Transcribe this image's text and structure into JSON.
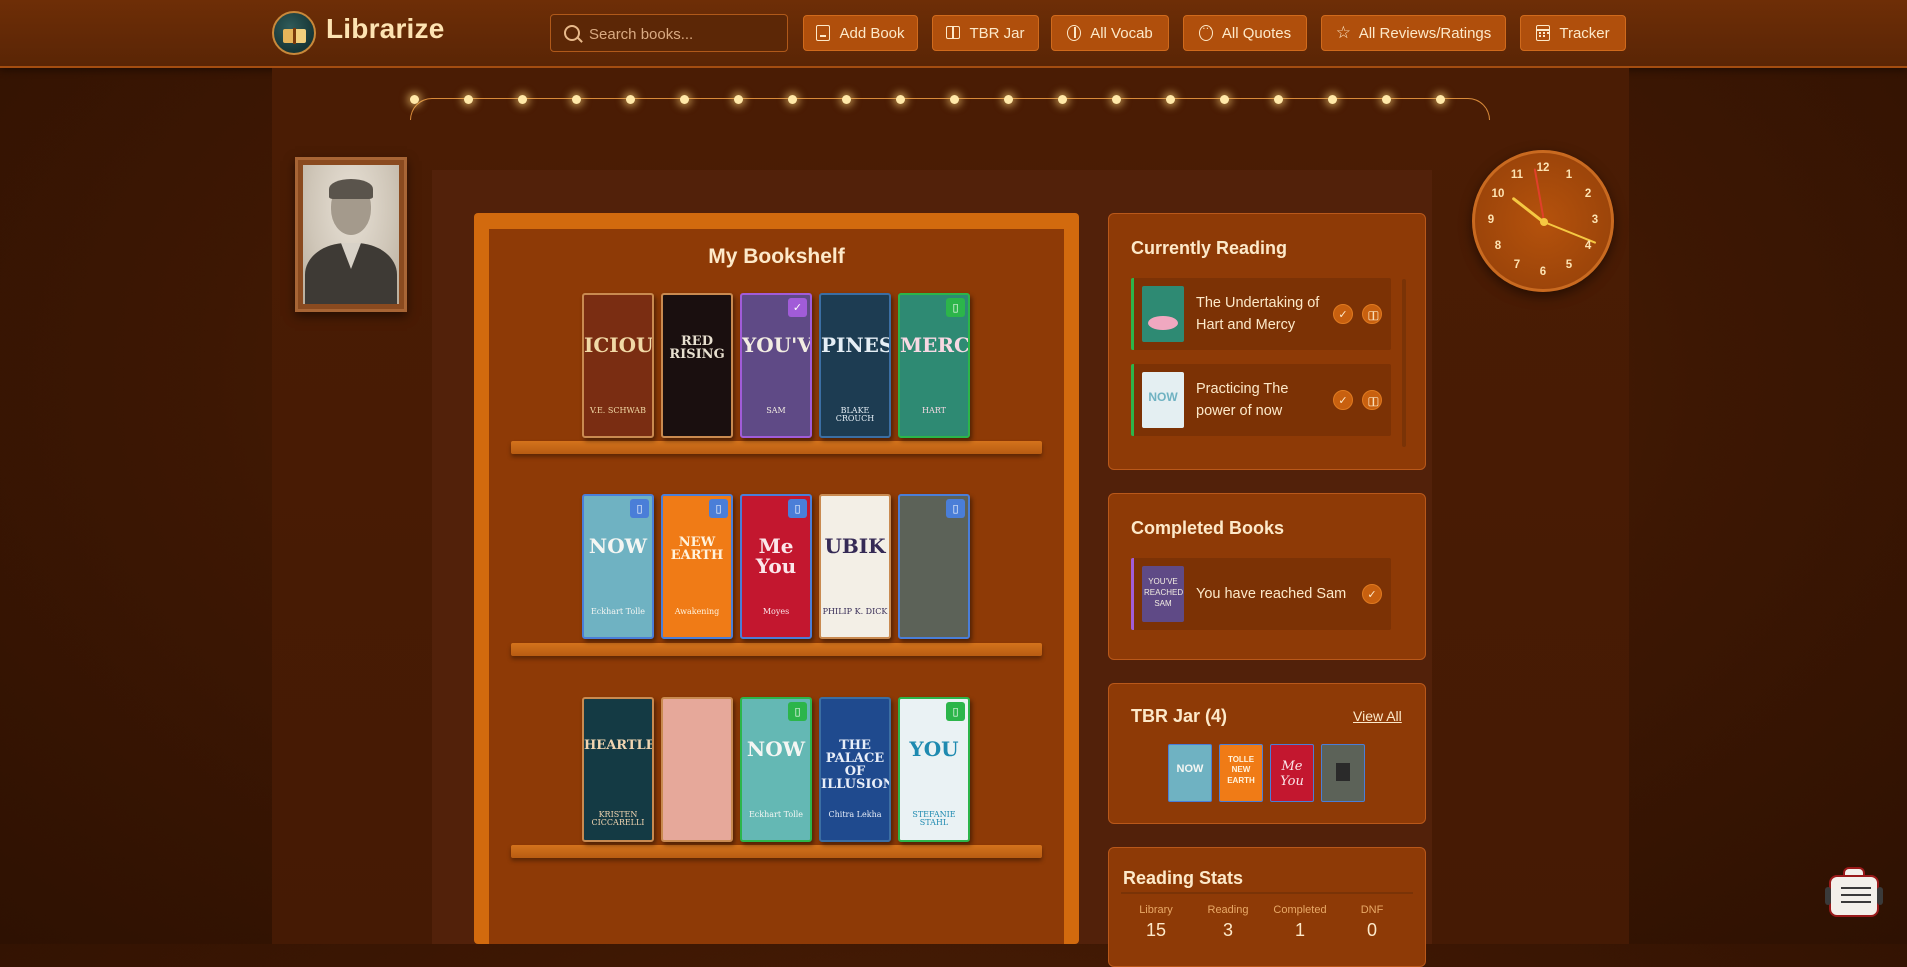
{
  "app": {
    "name": "Librarize"
  },
  "search": {
    "placeholder": "Search books..."
  },
  "nav": [
    {
      "label": "Add Book",
      "icon": "book-icon"
    },
    {
      "label": "TBR Jar",
      "icon": "open-book-icon"
    },
    {
      "label": "All Vocab",
      "icon": "brain-icon"
    },
    {
      "label": "All Quotes",
      "icon": "chat-icon"
    },
    {
      "label": "All Reviews/Ratings",
      "icon": "star-icon"
    },
    {
      "label": "Tracker",
      "icon": "calendar-icon"
    }
  ],
  "bookshelf": {
    "title": "My Bookshelf",
    "rows": [
      [
        {
          "cover_text": "ICIOU",
          "sub_text": "V.E. SCHWAB",
          "bg": "#7a2d12",
          "fg": "#f1d9a6",
          "border": "#c98a50",
          "badge": null
        },
        {
          "cover_text": "RED RISING",
          "sub_text": "",
          "bg": "#1a0f0f",
          "fg": "#e8e0d0",
          "border": "#c98a50",
          "badge": null
        },
        {
          "cover_text": "YOU'VE",
          "sub_text": "SAM",
          "bg": "#5f4a86",
          "fg": "#f2ede2",
          "border": "#a15cd8",
          "badge": "check"
        },
        {
          "cover_text": "PINES",
          "sub_text": "BLAKE CROUCH",
          "bg": "#1d3c52",
          "fg": "#e5eef5",
          "border": "#3b6ea3",
          "badge": null
        },
        {
          "cover_text": "MERCY",
          "sub_text": "HART",
          "bg": "#2e8a73",
          "fg": "#f7d8e3",
          "border": "#2cb54a",
          "badge": "reading"
        }
      ],
      [
        {
          "cover_text": "NOW",
          "sub_text": "Eckhart Tolle",
          "bg": "#6fb2c2",
          "fg": "#f4f6f3",
          "border": "#4a7ed8",
          "badge": "tbr"
        },
        {
          "cover_text": "NEW EARTH",
          "sub_text": "Awakening",
          "bg": "#f07b16",
          "fg": "#fff3dd",
          "border": "#4a7ed8",
          "badge": "tbr"
        },
        {
          "cover_text": "Me You",
          "sub_text": "Moyes",
          "bg": "#c3172f",
          "fg": "#fbe6ea",
          "border": "#4a7ed8",
          "badge": "tbr"
        },
        {
          "cover_text": "UBIK",
          "sub_text": "PHILIP K. DICK",
          "bg": "#f3efe6",
          "fg": "#352a55",
          "border": "#c98a50",
          "badge": null
        },
        {
          "cover_text": "",
          "sub_text": "",
          "bg": "#5c6258",
          "fg": "#2a2a2a",
          "border": "#4a7ed8",
          "badge": "tbr"
        }
      ],
      [
        {
          "cover_text": "HEARTLESS",
          "sub_text": "KRISTEN CICCARELLI",
          "bg": "#143a44",
          "fg": "#f1d5b1",
          "border": "#c98a50",
          "badge": null
        },
        {
          "cover_text": "",
          "sub_text": "",
          "bg": "#e6a89a",
          "fg": "#2a1a1a",
          "border": "#c98a50",
          "badge": null
        },
        {
          "cover_text": "NOW",
          "sub_text": "Eckhart Tolle",
          "bg": "#64b8b4",
          "fg": "#f4f6f3",
          "border": "#2cb54a",
          "badge": "reading"
        },
        {
          "cover_text": "THE PALACE OF ILLUSIONS",
          "sub_text": "Chitra Lekha",
          "bg": "#1f4a8e",
          "fg": "#e8eef8",
          "border": "#3b6ea3",
          "badge": null
        },
        {
          "cover_text": "YOU",
          "sub_text": "STEFANIE STAHL",
          "bg": "#eaf2f4",
          "fg": "#1e8ab0",
          "border": "#2cb54a",
          "badge": "reading"
        }
      ]
    ]
  },
  "currently_reading": {
    "title": "Currently Reading",
    "items": [
      {
        "title": "The Undertaking of Hart and Mercy",
        "thumb_bg": "#2e8a73"
      },
      {
        "title": "Practicing The power of now",
        "thumb_bg": "#6fb2c2"
      }
    ]
  },
  "completed": {
    "title": "Completed Books",
    "items": [
      {
        "title": "You have reached Sam",
        "thumb_bg": "#5f4a86"
      }
    ]
  },
  "tbr": {
    "title": "TBR Jar (4)",
    "view_all": "View All",
    "thumbs": [
      "#6fb2c2",
      "#f07b16",
      "#c3172f",
      "#5c6258"
    ]
  },
  "stats": {
    "title": "Reading Stats",
    "items": [
      {
        "label": "Library",
        "value": "15"
      },
      {
        "label": "Reading",
        "value": "3"
      },
      {
        "label": "Completed",
        "value": "1"
      },
      {
        "label": "DNF",
        "value": "0"
      }
    ]
  },
  "clock": {
    "numbers": [
      "12",
      "1",
      "2",
      "3",
      "4",
      "5",
      "6",
      "7",
      "8",
      "9",
      "10",
      "11"
    ]
  },
  "colors": {
    "accent": "#d26a0e",
    "reading": "#2cb54a",
    "tbr": "#4a7ed8",
    "completed": "#a15cd8"
  }
}
